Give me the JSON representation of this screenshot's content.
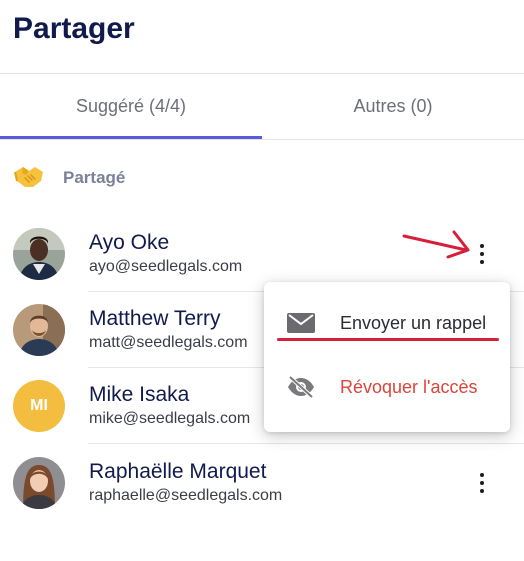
{
  "page": {
    "title": "Partager"
  },
  "tabs": [
    {
      "label": "Suggéré (4/4)",
      "active": true
    },
    {
      "label": "Autres (0)",
      "active": false
    }
  ],
  "section": {
    "icon": "handshake-icon",
    "label": "Partagé"
  },
  "people": [
    {
      "name": "Ayo Oke",
      "email": "ayo@seedlegals.com",
      "avatar": "photo"
    },
    {
      "name": "Matthew Terry",
      "email": "matt@seedlegals.com",
      "avatar": "photo"
    },
    {
      "name": "Mike Isaka",
      "email": "mike@seedlegals.com",
      "avatar": "initials",
      "initials": "MI"
    },
    {
      "name": "Raphaëlle Marquet",
      "email": "raphaelle@seedlegals.com",
      "avatar": "photo"
    }
  ],
  "menu": {
    "items": [
      {
        "icon": "envelope-icon",
        "label": "Envoyer un rappel"
      },
      {
        "icon": "eye-off-icon",
        "label": "Révoquer l'accès"
      }
    ]
  },
  "colors": {
    "title": "#101a4c",
    "tab_indicator": "#5a5bdc",
    "danger": "#d9453a",
    "annotation": "#d6203a",
    "avatar_initials_bg": "#f3bd3f"
  }
}
